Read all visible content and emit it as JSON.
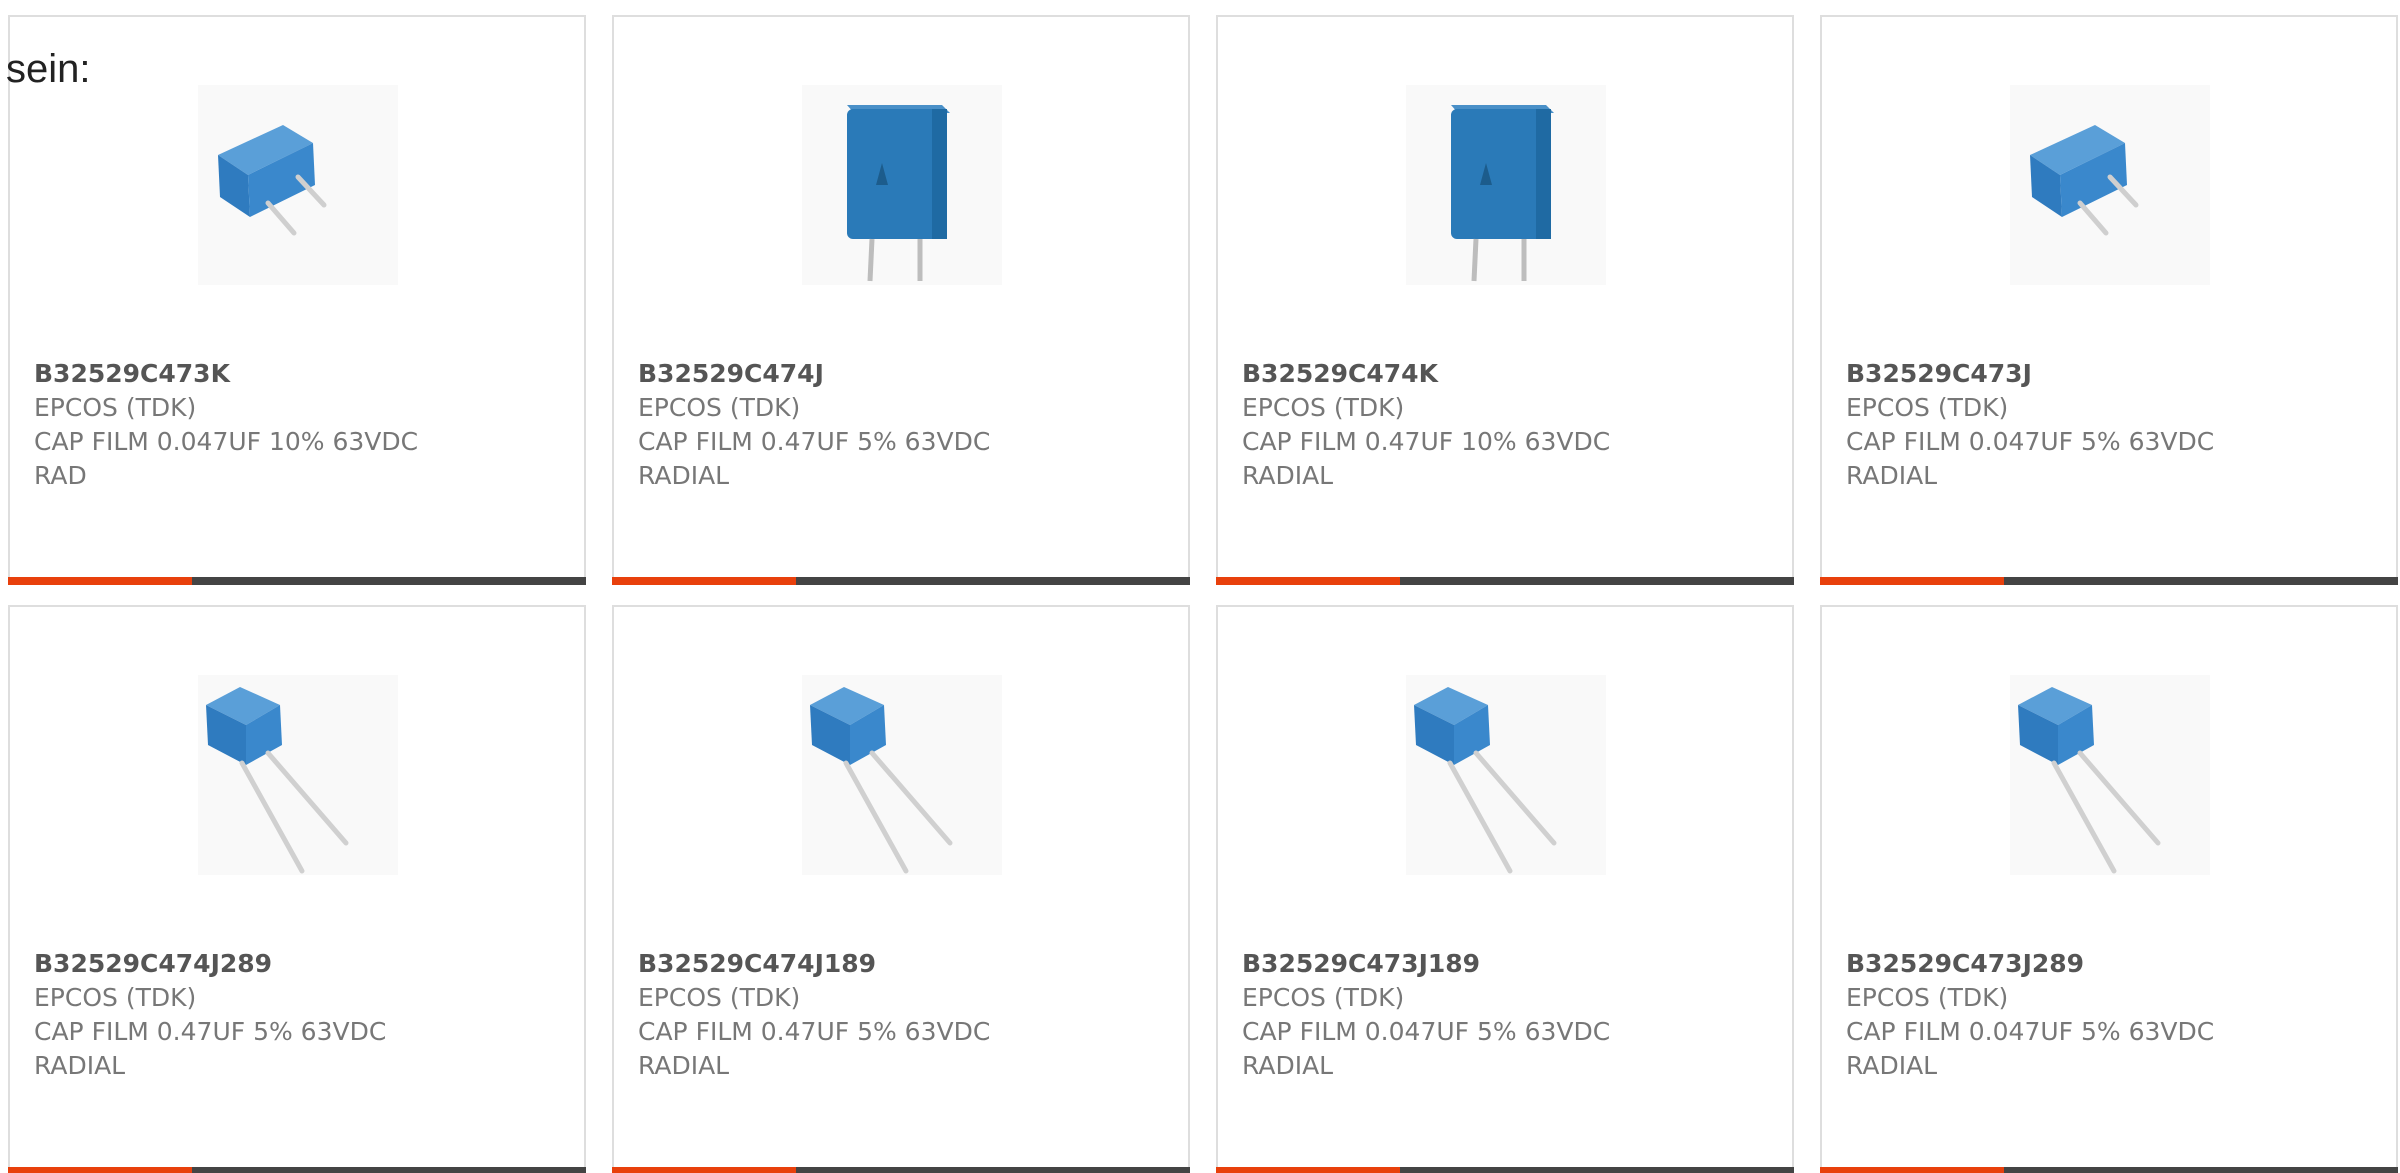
{
  "intro_text": "sein:",
  "colors": {
    "accent": "#e8400c",
    "bar": "#444444",
    "capacitor_blue": "#2f7bbf"
  },
  "products": [
    {
      "part_number": "B32529C473K",
      "manufacturer": "EPCOS (TDK)",
      "desc_line1": "CAP FILM 0.047UF 10% 63VDC",
      "desc_line2": "RAD",
      "image_icon": "capacitor-short-leads-icon"
    },
    {
      "part_number": "B32529C474J",
      "manufacturer": "EPCOS (TDK)",
      "desc_line1": "CAP FILM 0.47UF 5% 63VDC",
      "desc_line2": "RADIAL",
      "image_icon": "capacitor-upright-icon"
    },
    {
      "part_number": "B32529C474K",
      "manufacturer": "EPCOS (TDK)",
      "desc_line1": "CAP FILM 0.47UF 10% 63VDC",
      "desc_line2": "RADIAL",
      "image_icon": "capacitor-upright-icon"
    },
    {
      "part_number": "B32529C473J",
      "manufacturer": "EPCOS (TDK)",
      "desc_line1": "CAP FILM 0.047UF 5% 63VDC",
      "desc_line2": "RADIAL",
      "image_icon": "capacitor-short-leads-icon"
    },
    {
      "part_number": "B32529C474J289",
      "manufacturer": "EPCOS (TDK)",
      "desc_line1": "CAP FILM 0.47UF 5% 63VDC",
      "desc_line2": "RADIAL",
      "image_icon": "capacitor-long-leads-icon"
    },
    {
      "part_number": "B32529C474J189",
      "manufacturer": "EPCOS (TDK)",
      "desc_line1": "CAP FILM 0.47UF 5% 63VDC",
      "desc_line2": "RADIAL",
      "image_icon": "capacitor-long-leads-icon"
    },
    {
      "part_number": "B32529C473J189",
      "manufacturer": "EPCOS (TDK)",
      "desc_line1": "CAP FILM 0.047UF 5% 63VDC",
      "desc_line2": "RADIAL",
      "image_icon": "capacitor-long-leads-icon"
    },
    {
      "part_number": "B32529C473J289",
      "manufacturer": "EPCOS (TDK)",
      "desc_line1": "CAP FILM 0.047UF 5% 63VDC",
      "desc_line2": "RADIAL",
      "image_icon": "capacitor-long-leads-icon"
    }
  ]
}
